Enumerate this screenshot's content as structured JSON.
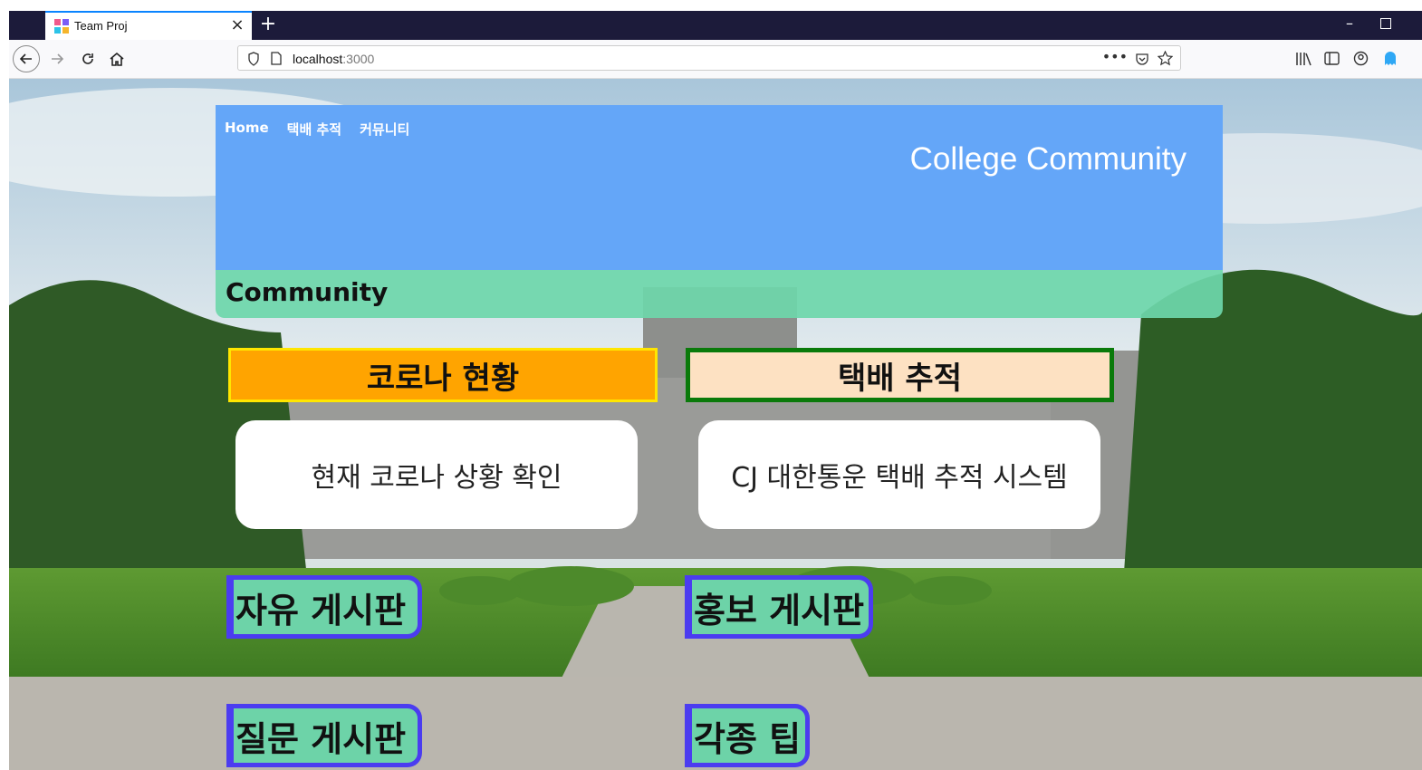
{
  "browser": {
    "tab_title": "Team Proj",
    "url_host": "localhost",
    "url_port": ":3000"
  },
  "header": {
    "nav_links": [
      "Home",
      "택배 추적",
      "커뮤니티"
    ],
    "site_title": "College Community",
    "section_label": "Community"
  },
  "sections": {
    "covid": {
      "title": "코로나 현황",
      "card_text": "현재 코로나 상황 확인"
    },
    "parcel": {
      "title": "택배 추적",
      "card_text": "CJ 대한통운 택배 추적 시스템"
    }
  },
  "boards": {
    "free": "자유 게시판",
    "promo": "홍보 게시판",
    "qna": "질문 게시판",
    "tips": "각종 팁"
  },
  "colors": {
    "header_blue": "#64a6f8",
    "community_green": "#6ed7aa",
    "covid_orange": "#ffa400",
    "parcel_peach": "#fde1c2",
    "board_border": "#4b3cf0"
  }
}
